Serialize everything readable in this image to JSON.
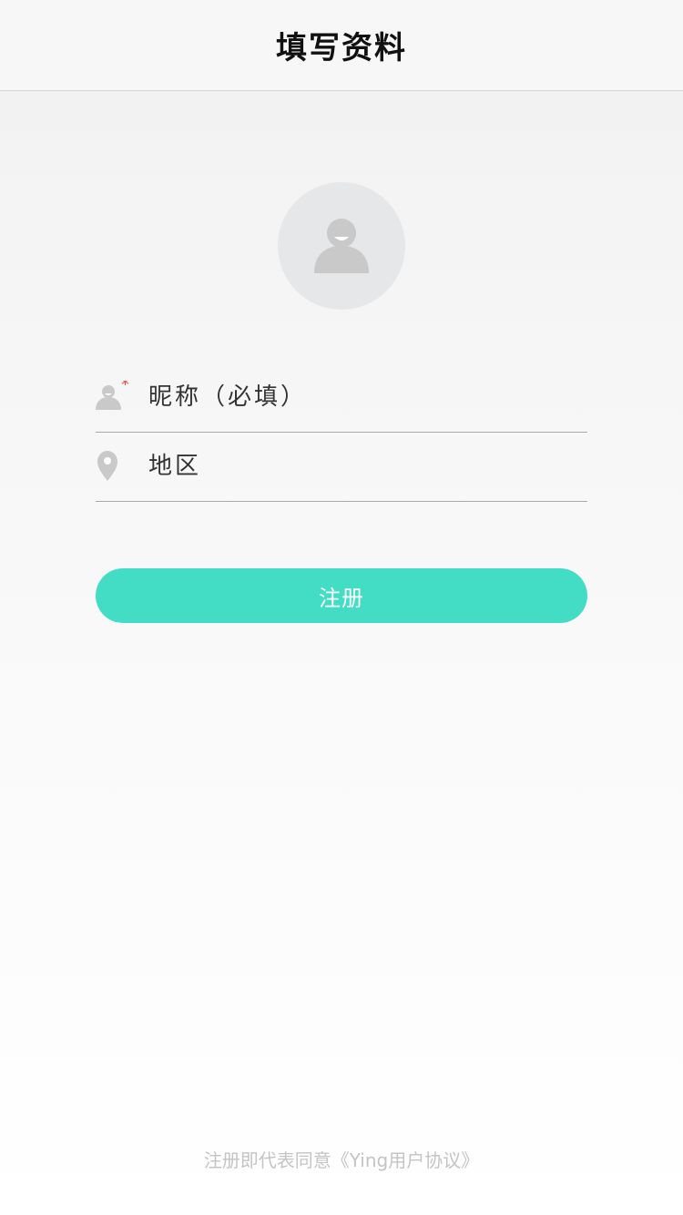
{
  "header": {
    "title": "填写资料"
  },
  "avatar": {
    "icon": "user-avatar-icon"
  },
  "form": {
    "nickname": {
      "placeholder": "昵称（必填）",
      "icon": "user-icon",
      "required_mark": "*",
      "required_color": "#e94b4b"
    },
    "region": {
      "placeholder": "地区",
      "icon": "location-pin-icon"
    },
    "submit_label": "注册"
  },
  "footer": {
    "agreement_prefix": "注册即代表同意",
    "agreement_link": "《Ying用户协议》"
  },
  "colors": {
    "accent": "#43dcc5",
    "icon_gray": "#c9c9c9",
    "avatar_bg": "#e6e7e9"
  }
}
